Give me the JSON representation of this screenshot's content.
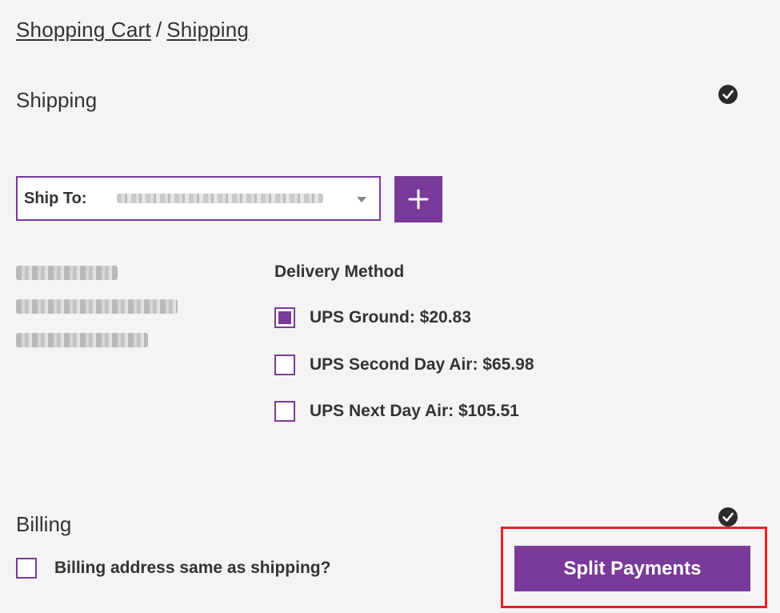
{
  "breadcrumb": {
    "cart": "Shopping Cart",
    "separator": "/",
    "current": "Shipping"
  },
  "shipping": {
    "title": "Shipping",
    "status_icon": "check-circle-icon",
    "ship_to_label": "Ship To:",
    "add_icon": "plus-icon",
    "delivery_title": "Delivery Method",
    "options": [
      {
        "label": "UPS Ground: $20.83",
        "checked": true
      },
      {
        "label": "UPS Second Day Air: $65.98",
        "checked": false
      },
      {
        "label": "UPS Next Day Air: $105.51",
        "checked": false
      }
    ]
  },
  "billing": {
    "title": "Billing",
    "status_icon": "check-circle-icon",
    "same_as_shipping_label": "Billing address same as shipping?",
    "same_as_shipping_checked": false,
    "split_button": "Split Payments"
  },
  "colors": {
    "accent": "#7a3a99",
    "highlight": "#e02424",
    "text": "#333333",
    "background": "#f4f4f4"
  }
}
